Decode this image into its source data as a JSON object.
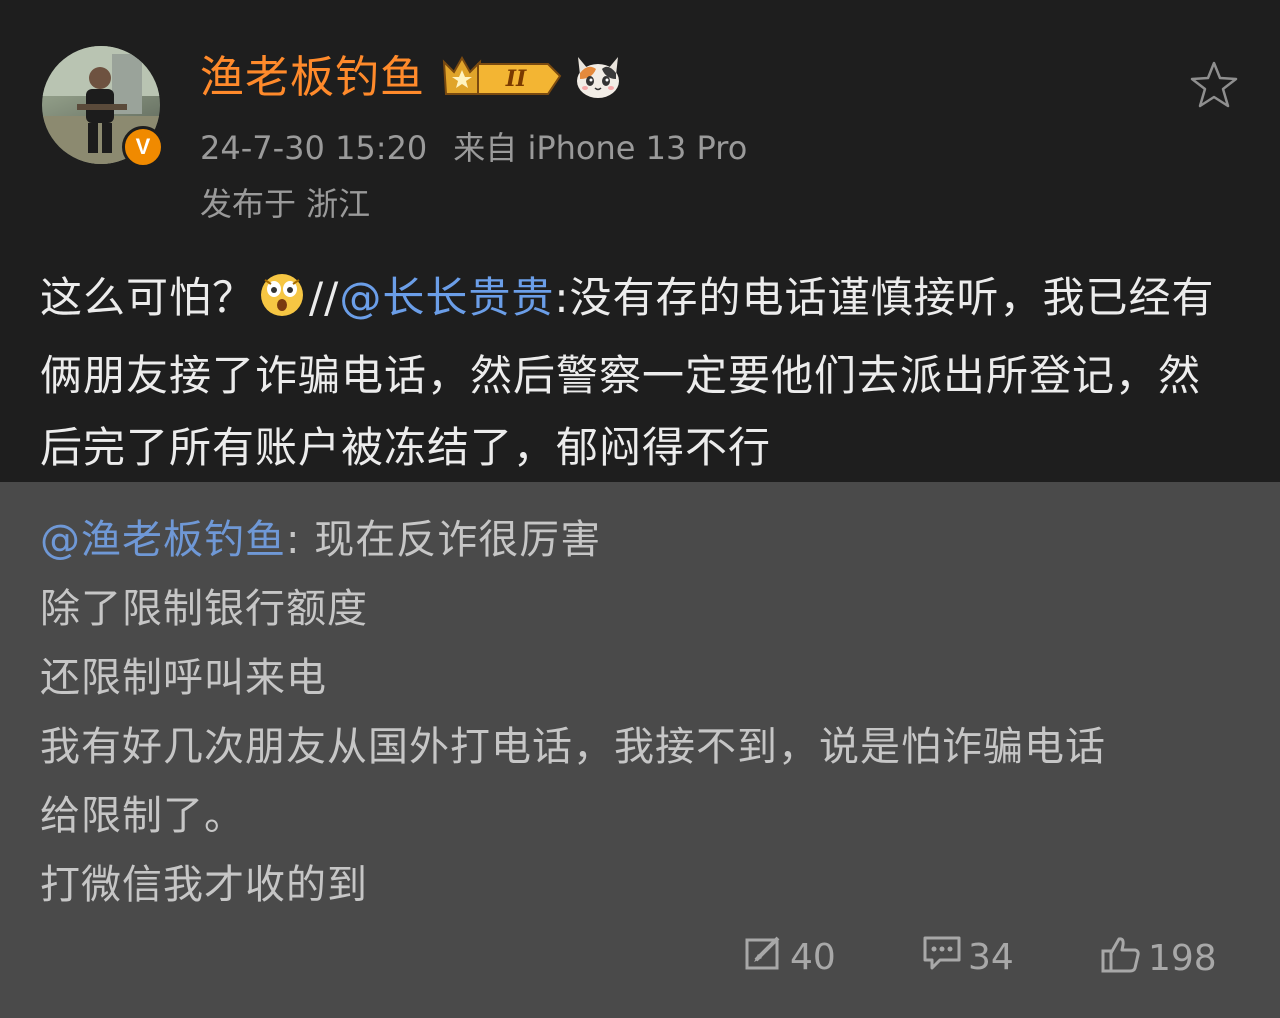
{
  "post": {
    "username": "渔老板钓鱼",
    "level_badge": "II",
    "timestamp": "24-7-30 15:20",
    "source": "来自 iPhone 13 Pro",
    "location": "发布于 浙江",
    "verified_badge": "V",
    "content": {
      "prefix": "这么可怕？",
      "separator": "//",
      "mention": "@长长贵贵",
      "body": ":没有存的电话谨慎接听，我已经有俩朋友接了诈骗电话，然后警察一定要他们去派出所登记，然后完了所有账户被冻结了，郁闷得不行"
    }
  },
  "repost": {
    "mention": "@渔老板钓鱼",
    "first_line_text": ": 现在反诈很厉害",
    "lines": [
      "除了限制银行额度",
      "还限制呼叫来电",
      "我有好几次朋友从国外打电话，我接不到，说是怕诈骗电话",
      "给限制了。",
      "打微信我才收的到"
    ]
  },
  "actions": {
    "reposts": "40",
    "comments": "34",
    "likes": "198"
  },
  "colors": {
    "username": "#ff8a2b",
    "mention": "#6b9ee8",
    "post_bg": "#1e1e1e",
    "repost_bg": "#4a4a4a",
    "verified": "#f08a00"
  },
  "icons": [
    "star-icon",
    "repost-icon",
    "comment-icon",
    "like-icon",
    "level-crown-icon",
    "cat-emoji-icon",
    "shocked-emoji-icon"
  ]
}
